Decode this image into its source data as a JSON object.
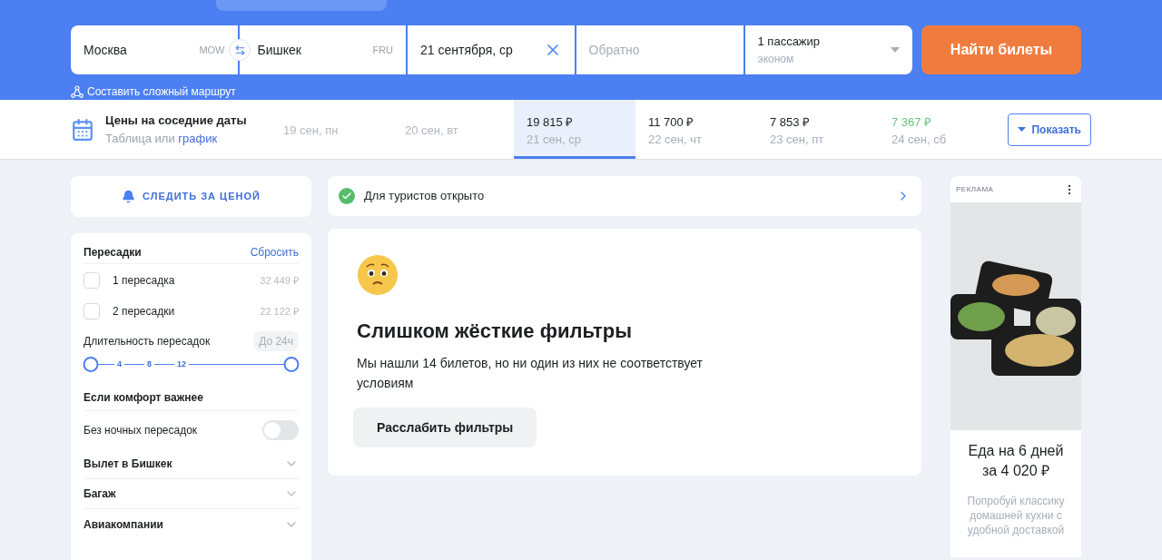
{
  "search": {
    "origin": {
      "city": "Москва",
      "code": "MOW"
    },
    "destination": {
      "city": "Бишкек",
      "code": "FRU"
    },
    "date": "21 сентября, ср",
    "return_placeholder": "Обратно",
    "passengers": "1 пассажир",
    "cabin": "эконом",
    "submit": "Найти билеты",
    "complex_route": "Составить сложный маршрут"
  },
  "dates_strip": {
    "title": "Цены на соседние даты",
    "subtitle": "Таблица или",
    "subtitle_link": "график",
    "show_button": "Показать",
    "days": [
      {
        "kind": "none",
        "date": "19 сен, пн",
        "selected": false
      },
      {
        "kind": "none",
        "date": "20 сен, вт",
        "selected": false
      },
      {
        "kind": "normal",
        "price": "19 815 ₽",
        "date": "21 сен, ср",
        "selected": true
      },
      {
        "kind": "normal",
        "price": "11 700 ₽",
        "date": "22 сен, чт",
        "selected": false
      },
      {
        "kind": "normal",
        "price": "7 853 ₽",
        "date": "23 сен, пт",
        "selected": false
      },
      {
        "kind": "best",
        "price": "7 367 ₽",
        "date": "24 сен, сб",
        "selected": false
      }
    ]
  },
  "price_alert": "СЛЕДИТЬ ЗА ЦЕНОЙ",
  "filters": {
    "stops_title": "Пересадки",
    "reset": "Сбросить",
    "stops": [
      {
        "label": "1 пересадка",
        "price": "32 449 ₽",
        "checked": false
      },
      {
        "label": "2 пересадки",
        "price": "22 122 ₽",
        "checked": false
      }
    ],
    "duration_title": "Длительность пересадок",
    "duration_value": "До 24ч",
    "duration_marks": [
      "4",
      "8",
      "12"
    ],
    "duration_thumbs": [
      {
        "level": 0
      },
      {
        "level": 1
      }
    ],
    "comfort_title": "Если комфорт важнее",
    "night_label": "Без ночных пересадок",
    "night_on": false,
    "sections": [
      {
        "label": "Вылет в Бишкек",
        "expanded": false
      },
      {
        "label": "Багаж",
        "expanded": false
      },
      {
        "label": "Авиакомпании",
        "expanded": false
      }
    ]
  },
  "notice": "Для туристов открыто",
  "empty_result": {
    "title": "Слишком жёсткие фильтры",
    "text": "Мы нашли 14 билетов, но ни один из них не соответствует условиям",
    "button": "Расслабить фильтры"
  },
  "ad": {
    "label": "РЕКЛАМА",
    "title": "Еда на 6 дней за 4 020 ₽",
    "text": "Попробуй классику домашней кухни с удобной доставкой"
  }
}
